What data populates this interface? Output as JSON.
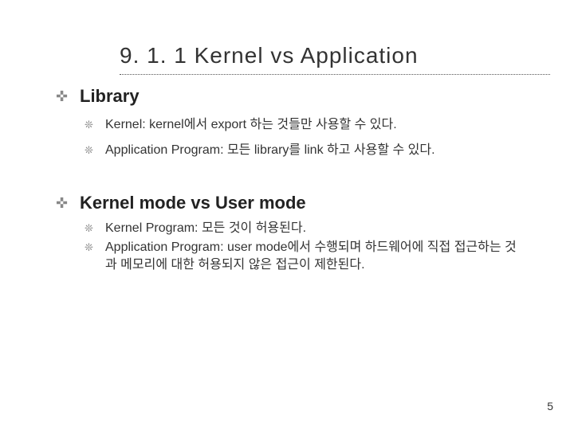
{
  "title": "9. 1. 1 Kernel vs Application",
  "sections": [
    {
      "heading": "Library",
      "items": [
        "Kernel: kernel에서 export 하는 것들만 사용할 수 있다.",
        "Application Program: 모든 library를 link 하고 사용할 수 있다."
      ]
    },
    {
      "heading": "Kernel mode vs User mode",
      "items": [
        "Kernel Program: 모든 것이 허용된다.",
        "Application Program: user mode에서 수행되며 하드웨어에 직접 접근하는 것과 메모리에 대한 허용되지 않은 접근이 제한된다."
      ]
    }
  ],
  "bullets": {
    "level1": "✜",
    "level2": "❊"
  },
  "page_number": "5"
}
